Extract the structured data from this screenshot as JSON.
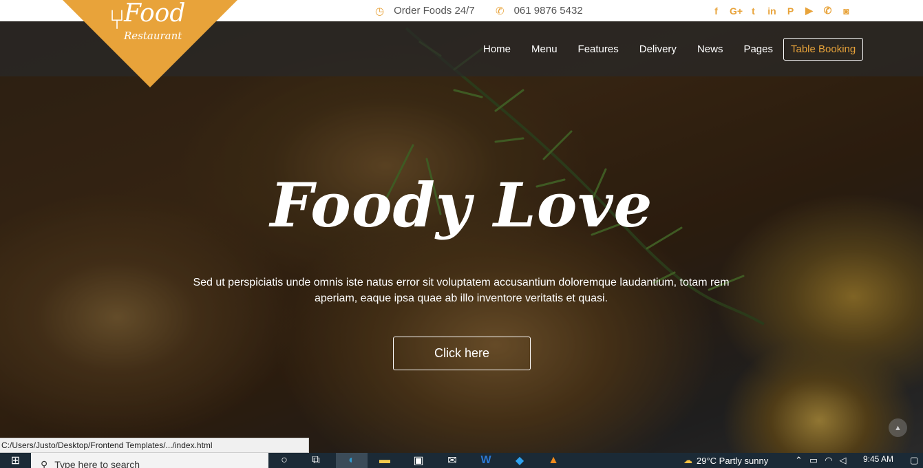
{
  "topbar": {
    "order_text": "Order Foods 24/7",
    "phone_text": "061 9876 5432",
    "social_icons": [
      "facebook-icon",
      "google-plus-icon",
      "twitter-icon",
      "linkedin-icon",
      "pinterest-icon",
      "youtube-icon",
      "phone-icon",
      "instagram-icon"
    ],
    "social_glyphs": [
      "f",
      "G+",
      "t",
      "in",
      "P",
      "▶",
      "✆",
      "◙"
    ]
  },
  "logo": {
    "line1": "Food",
    "line2": "Restaurant"
  },
  "nav": {
    "items": [
      "Home",
      "Menu",
      "Features",
      "Delivery",
      "News",
      "Pages"
    ],
    "booking": "Table Booking"
  },
  "hero": {
    "headline": "Foody Love",
    "subtext": "Sed ut perspiciatis unde omnis iste natus error sit voluptatem accusantium doloremque laudantium, totam rem aperiam, eaque ipsa quae ab illo inventore veritatis et quasi.",
    "button": "Click here"
  },
  "status_url": "C:/Users/Justo/Desktop/Frontend Templates/.../index.html",
  "taskbar": {
    "search_placeholder": "Type here to search",
    "weather": "29°C  Partly sunny",
    "time": "9:45 AM"
  },
  "colors": {
    "accent": "#e8a33a",
    "navbar_bg": "#282828",
    "taskbar_bg": "#1b2a36"
  }
}
